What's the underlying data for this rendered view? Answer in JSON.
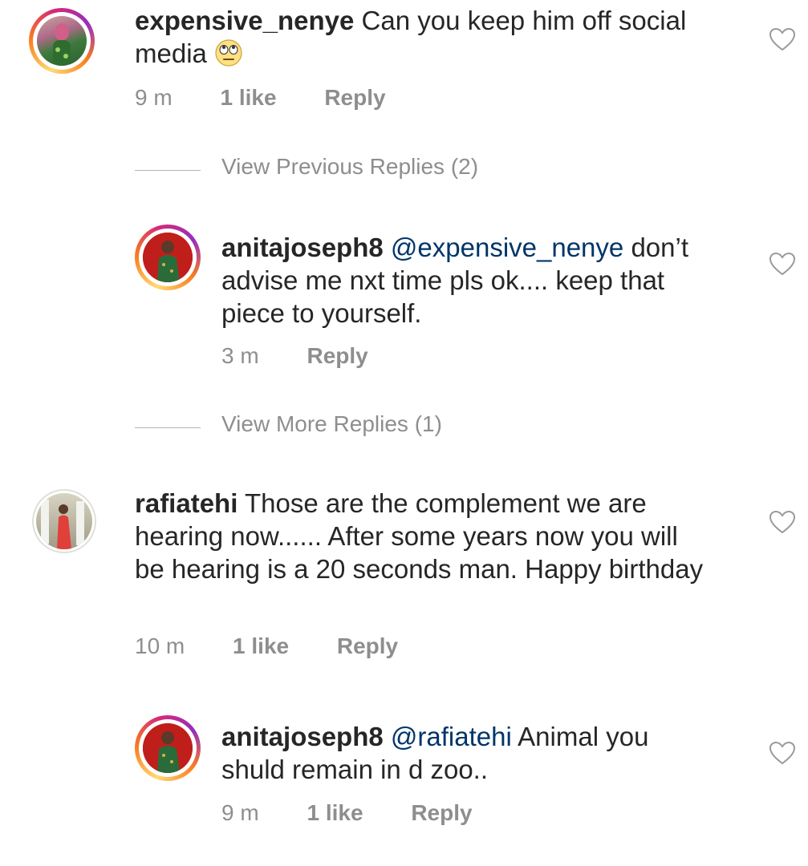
{
  "comments": [
    {
      "username": "expensive_nenye",
      "text": "Can you keep him off social media",
      "emoji": "face-with-rolling-eyes",
      "time": "9 m",
      "likes": "1 like",
      "reply_label": "Reply"
    },
    {
      "username": "anitajoseph8",
      "mention": "@expensive_nenye",
      "text": "don’t advise me nxt time pls ok.... keep that piece to yourself.",
      "time": "3 m",
      "reply_label": "Reply"
    },
    {
      "username": "rafiatehi",
      "text": "Those are the complement we are hearing now...... After some years now you will be hearing is a 20 seconds man. Happy birthday",
      "time": "10 m",
      "likes": "1 like",
      "reply_label": "Reply"
    },
    {
      "username": "anitajoseph8",
      "mention": "@rafiatehi",
      "text": "Animal you shuld remain in d zoo..",
      "time": "9 m",
      "likes": "1 like",
      "reply_label": "Reply"
    }
  ],
  "view_previous_replies": "View Previous Replies (2)",
  "view_more_replies": "View More Replies (1)",
  "colors": {
    "text": "#262626",
    "muted": "#8e8e8e",
    "mention": "#003569"
  },
  "icons": {
    "like": "heart-outline-icon"
  }
}
